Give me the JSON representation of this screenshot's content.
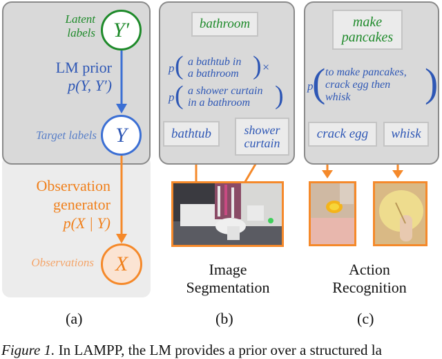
{
  "panel_a": {
    "latent_label": "Latent labels",
    "latent_node": "Y′",
    "prior_title": "LM prior",
    "prior_formula": "p(Y, Y′)",
    "target_label": "Target labels",
    "target_node": "Y",
    "observation_title_line1": "Observation",
    "observation_title_line2": "generator",
    "observation_formula": "p(X | Y)",
    "observations_label": "Observations",
    "observation_node": "X"
  },
  "panel_b": {
    "top_label": "bathroom",
    "p1": "p",
    "term1_line1": "a bathtub in",
    "term1_line2": "a bathroom",
    "times": "×",
    "p2": "p",
    "term2_line1": "a shower curtain",
    "term2_line2": "in a bathroom",
    "label_left": "bathtub",
    "label_right_line1": "shower",
    "label_right_line2": "curtain",
    "caption_line1": "Image",
    "caption_line2": "Segmentation"
  },
  "panel_c": {
    "top_label_line1": "make",
    "top_label_line2": "pancakes",
    "p": "p",
    "term_line1": "to make pancakes,",
    "term_line2": "crack egg then",
    "term_line3": "whisk",
    "label_left": "crack egg",
    "label_right": "whisk",
    "caption_line1": "Action",
    "caption_line2": "Recognition"
  },
  "sublabels": [
    "(a)",
    "(b)",
    "(c)"
  ],
  "figure_caption": "Figure 1. In LAMPP, the LM provides a prior over a structured la",
  "colors": {
    "latent": "#1e8a2a",
    "prior": "#2e57b5",
    "observation": "#f0801c",
    "panel_bg": "#d9d9d9",
    "panel_border": "#8a8a8a"
  }
}
